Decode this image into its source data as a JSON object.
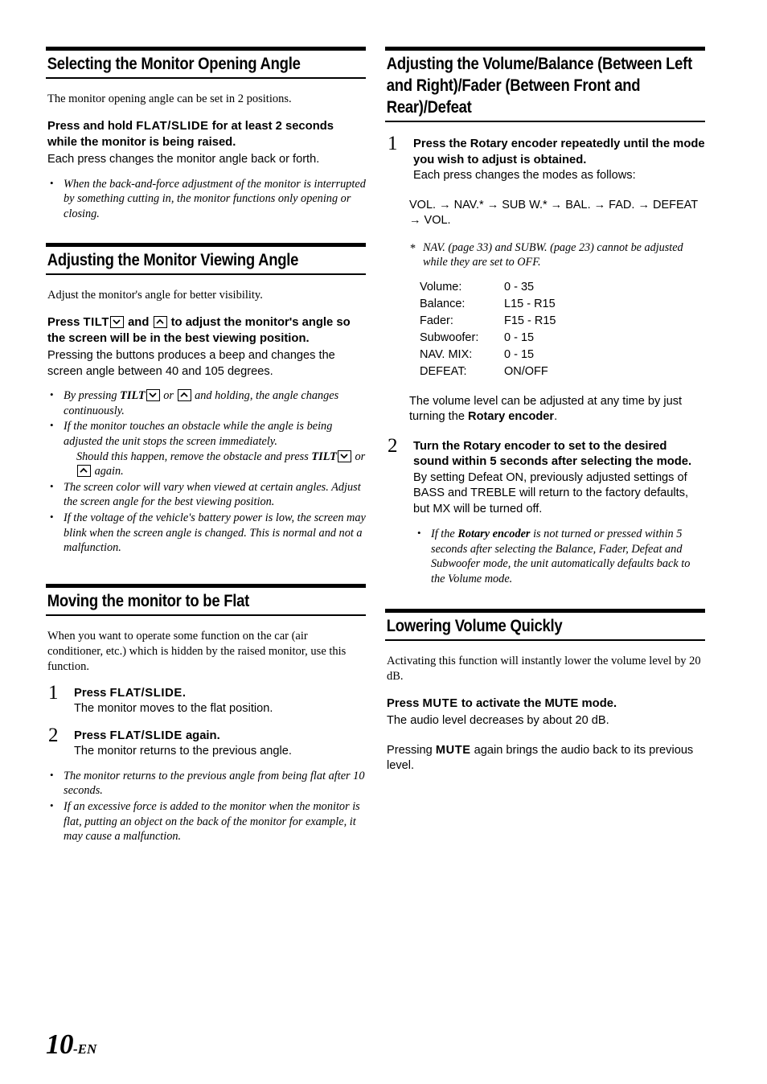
{
  "page": {
    "number": "10",
    "lang_suffix": "-EN"
  },
  "left_column": {
    "section1": {
      "title": "Selecting the Monitor Opening Angle",
      "intro": "The monitor opening angle can be set in 2 positions.",
      "instruction_pre": "Press and hold ",
      "instruction_key": "FLAT/SLIDE",
      "instruction_post": " for at least 2 seconds while the monitor is being raised.",
      "detail": "Each press changes the monitor angle back or forth.",
      "notes": [
        "When the back-and-force adjustment of the monitor is interrupted by something cutting in, the monitor functions only opening or closing."
      ]
    },
    "section2": {
      "title": "Adjusting the Monitor Viewing Angle",
      "intro": "Adjust the monitor's angle for better visibility.",
      "instruction_pre": "Press ",
      "instruction_key": "TILT",
      "instruction_mid": " and ",
      "instruction_post": " to adjust the monitor's angle so the screen will be in the best viewing position.",
      "detail": "Pressing the buttons produces a beep and changes the screen angle between 40 and 105 degrees.",
      "note1_pre": "By pressing ",
      "note1_key": "TILT",
      "note1_mid": " or ",
      "note1_post": " and holding, the angle changes continuously.",
      "note2_line1": "If the monitor touches an obstacle while the angle is being adjusted the unit stops the screen immediately.",
      "note2_line2_pre": "Should this happen, remove the obstacle and press ",
      "note2_key": "TILT",
      "note2_mid": " or ",
      "note2_post": " again.",
      "note3": "The screen color will vary when viewed at certain angles. Adjust the screen angle for the best viewing position.",
      "note4": "If the voltage of the vehicle's battery power is low, the screen may blink when the screen angle is changed. This is normal and not a malfunction."
    },
    "section3": {
      "title": "Moving the monitor to be Flat",
      "intro": "When you want to operate some function on the car (air conditioner, etc.) which is hidden by the raised monitor, use this function.",
      "steps": [
        {
          "num": "1",
          "bold_pre": "Press ",
          "bold_key": "FLAT/SLIDE",
          "bold_post": ".",
          "detail": "The monitor moves to the flat position."
        },
        {
          "num": "2",
          "bold_pre": "Press ",
          "bold_key": "FLAT/SLIDE",
          "bold_post": " again.",
          "detail": "The monitor returns to the previous angle."
        }
      ],
      "notes": [
        "The monitor returns to the previous angle from being flat after 10 seconds.",
        "If an excessive force is added to the monitor when the monitor is flat, putting an object on the back of the monitor for example, it may cause a malfunction."
      ]
    }
  },
  "right_column": {
    "section1": {
      "title": "Adjusting the Volume/Balance (Between Left and Right)/Fader (Between Front and Rear)/Defeat",
      "step1": {
        "num": "1",
        "bold_pre": "Press the ",
        "bold_key": "Rotary encoder",
        "bold_post": " repeatedly until the mode you wish to adjust is obtained.",
        "detail": "Each press changes the modes as follows:",
        "sequence": "VOL. → NAV.* → SUB W.* → BAL. → FAD. → DEFEAT → VOL.",
        "sequence_parts": [
          "VOL.",
          "NAV.",
          "SUB W.",
          "BAL.",
          "FAD.",
          "DEFEAT",
          "VOL."
        ],
        "footnote": "NAV. (page 33) and SUBW. (page 23) cannot be adjusted while they are set to OFF.",
        "modes_table": [
          {
            "label": "Volume:",
            "range": "0 - 35"
          },
          {
            "label": "Balance:",
            "range": "L15 - R15"
          },
          {
            "label": "Fader:",
            "range": "F15 - R15"
          },
          {
            "label": "Subwoofer:",
            "range": "0 - 15"
          },
          {
            "label": "NAV. MIX:",
            "range": "0 - 15"
          },
          {
            "label": "DEFEAT:",
            "range": "ON/OFF"
          }
        ],
        "tail_pre": "The volume level can be adjusted at any time by just turning the ",
        "tail_key": "Rotary encoder",
        "tail_post": "."
      },
      "step2": {
        "num": "2",
        "bold_pre": "Turn the ",
        "bold_key": "Rotary encoder",
        "bold_post": " to set to the desired sound within 5 seconds after selecting the mode.",
        "detail": "By setting Defeat ON, previously adjusted settings of BASS and TREBLE will return to the factory defaults, but MX will be turned off.",
        "note_pre": "If the ",
        "note_key": "Rotary encoder",
        "note_post": " is not turned or pressed within 5 seconds after selecting the Balance, Fader, Defeat and Subwoofer mode, the unit automatically defaults back to the Volume mode."
      }
    },
    "section2": {
      "title": "Lowering Volume Quickly",
      "intro": "Activating this function will instantly lower the volume level by 20 dB.",
      "instruction_pre": "Press ",
      "instruction_key": "MUTE",
      "instruction_post": " to activate the MUTE mode.",
      "detail": "The audio level decreases by about 20 dB.",
      "closing_pre": "Pressing ",
      "closing_key": "MUTE",
      "closing_post": " again brings the audio back to its previous level."
    }
  }
}
